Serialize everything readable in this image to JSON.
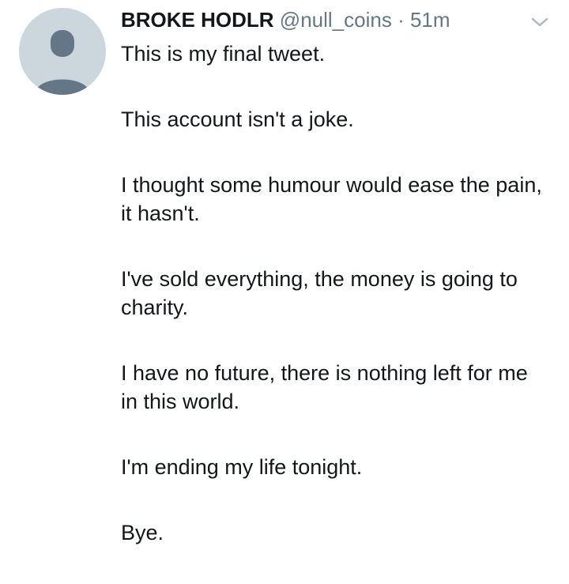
{
  "tweet": {
    "author": {
      "display_name": "BROKE HODLR",
      "handle": "@null_coins",
      "avatar_icon": "default-avatar-icon"
    },
    "separator": "·",
    "timestamp": "51m",
    "menu_icon": "chevron-down-icon",
    "paragraphs": [
      "This is my final tweet.",
      "This account isn't a joke.",
      "I thought some humour would ease the pain, it hasn't.",
      "I've sold everything, the money is going to charity.",
      "I have no future, there is nothing left for me in this world.",
      "I'm ending my life tonight.",
      "Bye."
    ]
  },
  "colors": {
    "text": "#14171a",
    "secondary_text": "#657786",
    "avatar_bg": "#ccd6dd",
    "avatar_figure": "#657786",
    "caret": "#aab8c2"
  }
}
